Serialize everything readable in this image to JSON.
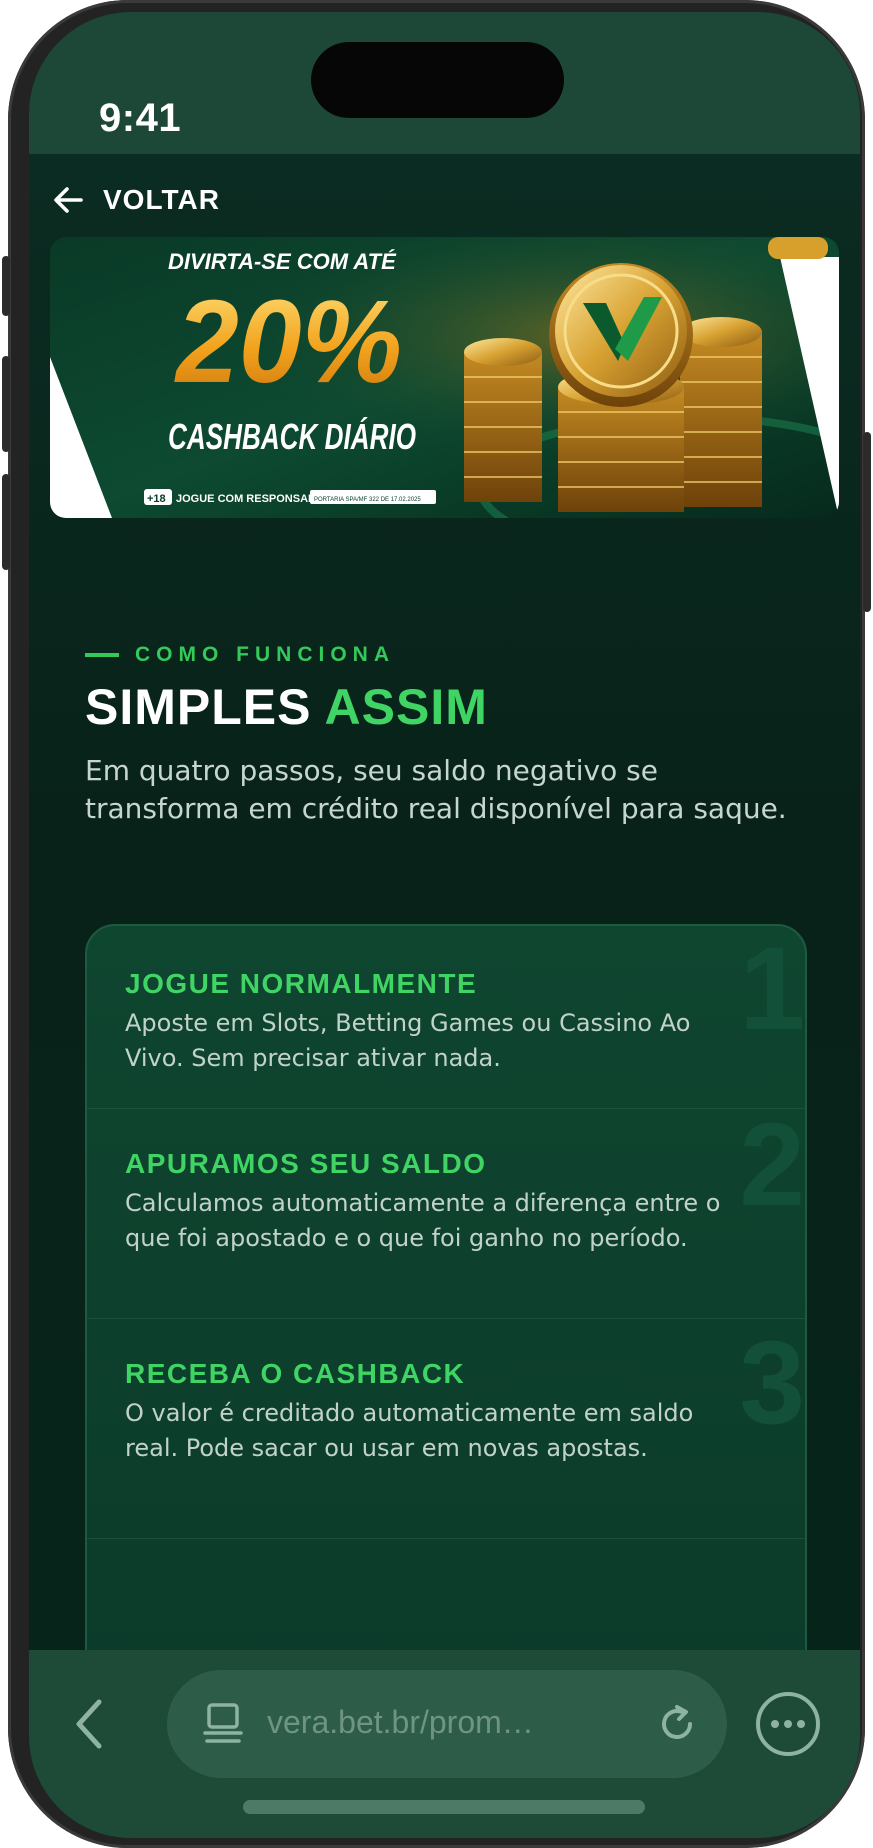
{
  "status_bar": {
    "time": "9:41"
  },
  "header": {
    "back_label": "VOLTAR"
  },
  "banner": {
    "kicker": "DIVIRTA-SE COM ATÉ",
    "percent": "20%",
    "headline": "CASHBACK DIÁRIO",
    "age": "+18",
    "responsible": "JOGUE COM RESPONSABILIDADE",
    "license": "PORTARIA SPA/MF 322 DE 17.02.2025"
  },
  "section": {
    "eyebrow": "COMO FUNCIONA",
    "heading_plain": "SIMPLES",
    "heading_accent": "ASSIM",
    "intro": "Em quatro passos, seu saldo negativo se transforma em crédito real disponível para saque."
  },
  "steps": [
    {
      "number": "1",
      "title": "JOGUE NORMALMENTE",
      "description": "Aposte em Slots, Betting Games ou Cassino Ao Vivo. Sem precisar ativar nada."
    },
    {
      "number": "2",
      "title": "APURAMOS SEU SALDO",
      "description": "Calculamos automaticamente a diferença entre o que foi apostado e o que foi ganho no período."
    },
    {
      "number": "3",
      "title": "RECEBA O CASHBACK",
      "description": "O valor é creditado automaticamente em saldo real. Pode sacar ou usar em novas apostas."
    }
  ],
  "browser": {
    "url": "vera.bet.br/prom…"
  },
  "colors": {
    "accent_green": "#3fd463",
    "page_bg": "#0b2c22",
    "card_bg": "#0f4630",
    "bar_bg": "#1e4a38"
  },
  "icons": [
    "back-arrow-icon",
    "chevron-left-icon",
    "tab-overview-icon",
    "reload-icon",
    "more-ellipsis-icon"
  ]
}
